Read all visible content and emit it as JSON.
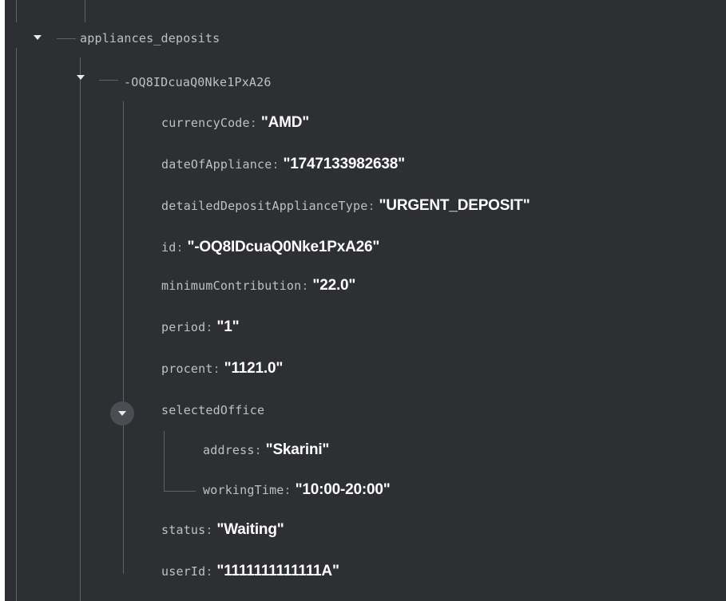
{
  "tree": {
    "root_key": "appliances_deposits",
    "entry_key": "-OQ8IDcuaQ0Nke1PxA26",
    "fields": [
      {
        "key": "currencyCode",
        "value": "\"AMD\""
      },
      {
        "key": "dateOfAppliance",
        "value": "\"1747133982638\""
      },
      {
        "key": "detailedDepositApplianceType",
        "value": "\"URGENT_DEPOSIT\""
      },
      {
        "key": "id",
        "value": "\"-OQ8IDcuaQ0Nke1PxA26\""
      },
      {
        "key": "minimumContribution",
        "value": "\"22.0\""
      },
      {
        "key": "period",
        "value": "\"1\""
      },
      {
        "key": "procent",
        "value": "\"1121.0\""
      }
    ],
    "selected_office": {
      "key": "selectedOffice",
      "fields": [
        {
          "key": "address",
          "value": "\"Skarini\""
        },
        {
          "key": "workingTime",
          "value": "\"10:00-20:00\""
        }
      ]
    },
    "trailing_fields": [
      {
        "key": "status",
        "value": "\"Waiting\""
      },
      {
        "key": "userId",
        "value": "\"1111111111111A\""
      }
    ],
    "colon": ":"
  },
  "icons": {
    "expand": "caret-down-icon"
  },
  "colors": {
    "background": "#2d2f33",
    "key_text": "#bdc1c6",
    "value_text": "#ffffff",
    "guide_line": "#5f6368"
  }
}
